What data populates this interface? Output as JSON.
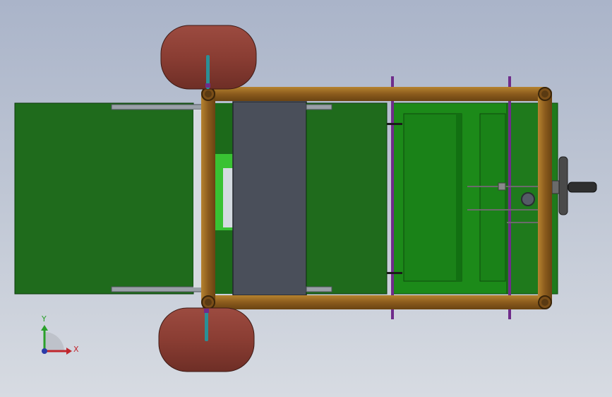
{
  "viewport": {
    "background_top": "#aab4c9",
    "background_bottom": "#d7dbe2"
  },
  "colors": {
    "frame_tube": "#8a5a1c",
    "frame_tube_highlight": "#b5822f",
    "wheel": "#8e3f33",
    "wheel_highlight": "#a9544a",
    "dark_green_panel": "#1f6b1c",
    "bright_green_panel": "#2b9a22",
    "mid_green": "#1b8a19",
    "seat_pad": "#4a4f5a",
    "rod": "#6f2c8a",
    "steering_wheel": "#4a4a4a",
    "axle": "#2b8f96"
  },
  "triad": {
    "x_label": "X",
    "y_label": "Y",
    "x_color": "#c0262d",
    "y_color": "#2aa02a",
    "z_color": "#2b3aa8"
  }
}
